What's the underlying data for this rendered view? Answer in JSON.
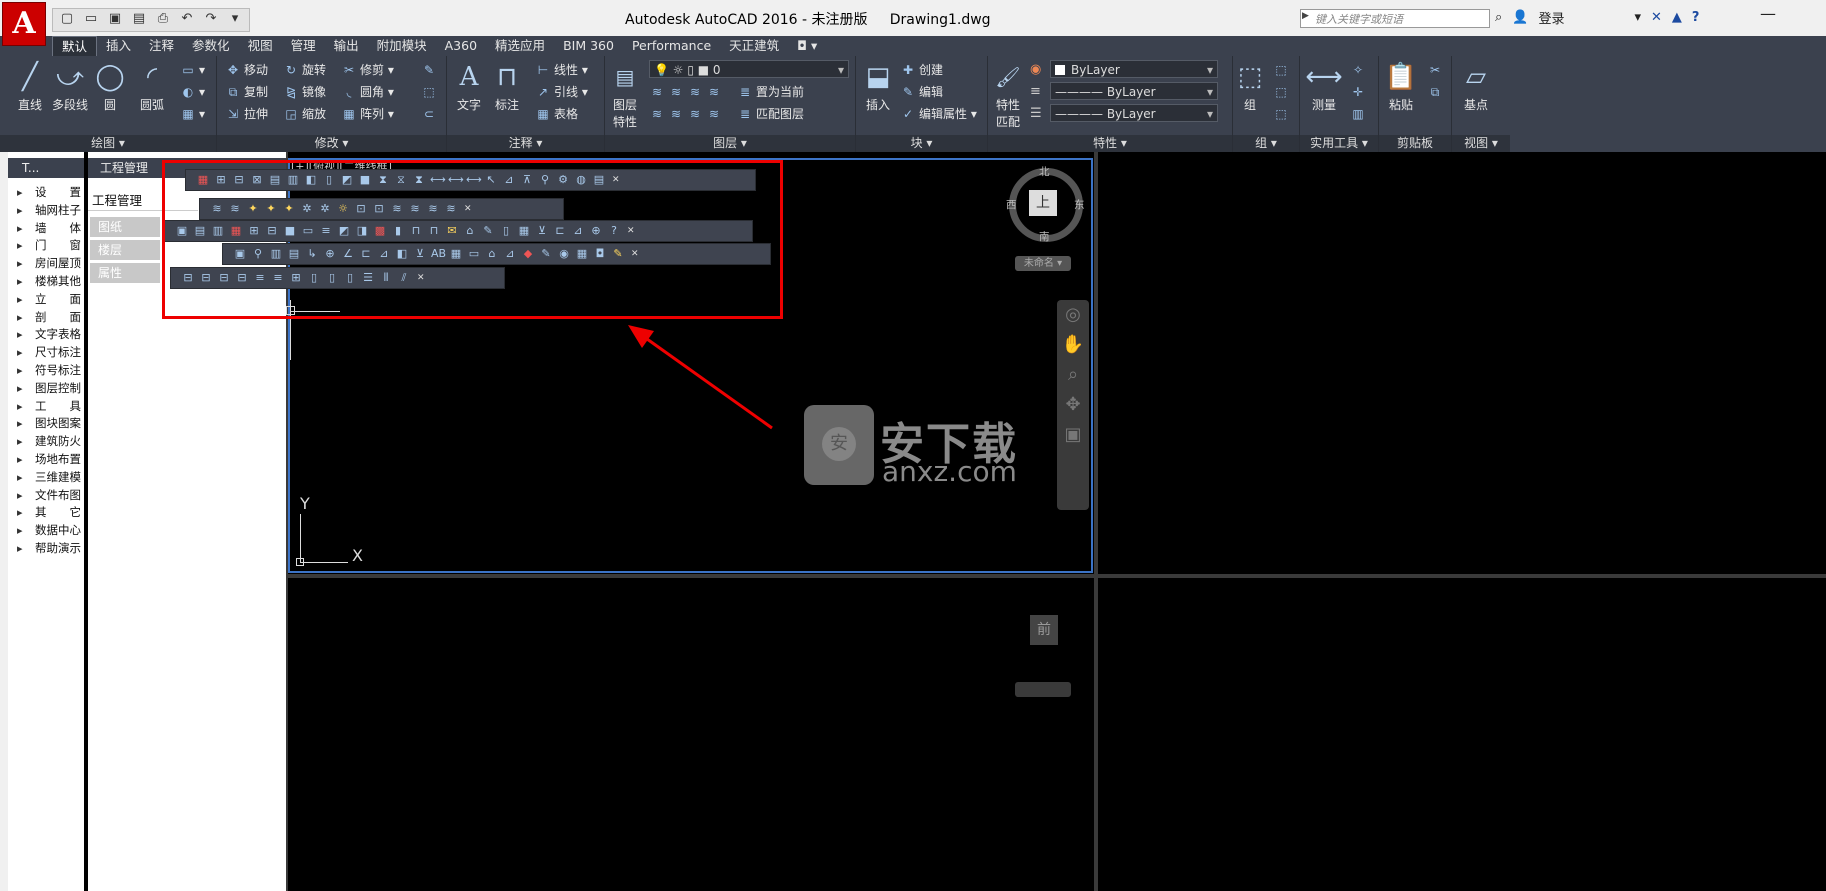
{
  "app": {
    "logo": "A",
    "window_title": "Autodesk AutoCAD 2016 - 未注册版     Drawing1.dwg",
    "search_placeholder": "键入关键字或短语",
    "login_label": "登录"
  },
  "qat": [
    "new",
    "open",
    "save",
    "save-as",
    "print",
    "undo",
    "redo",
    "menu"
  ],
  "tabs": [
    {
      "label": "默认",
      "active": true
    },
    {
      "label": "插入"
    },
    {
      "label": "注释"
    },
    {
      "label": "参数化"
    },
    {
      "label": "视图"
    },
    {
      "label": "管理"
    },
    {
      "label": "输出"
    },
    {
      "label": "附加模块"
    },
    {
      "label": "A360"
    },
    {
      "label": "精选应用"
    },
    {
      "label": "BIM 360"
    },
    {
      "label": "Performance"
    },
    {
      "label": "天正建筑"
    }
  ],
  "ribbon": {
    "draw": {
      "title": "绘图",
      "line": "直线",
      "polyline": "多段线",
      "circle": "圆",
      "arc": "圆弧"
    },
    "modify": {
      "title": "修改",
      "move": "移动",
      "rotate": "旋转",
      "trim": "修剪",
      "copy": "复制",
      "mirror": "镜像",
      "fillet": "圆角",
      "stretch": "拉伸",
      "scale": "缩放",
      "array": "阵列"
    },
    "annotation": {
      "title": "注释",
      "text": "文字",
      "dimension": "标注",
      "linear": "线性",
      "leader": "引线",
      "table": "表格"
    },
    "layers": {
      "title": "图层",
      "props_line1": "图层",
      "props_line2": "特性",
      "current_layer": "0",
      "set_current": "置为当前",
      "match_layer": "匹配图层"
    },
    "block": {
      "title": "块",
      "insert": "插入",
      "create": "创建",
      "edit": "编辑",
      "edit_attr": "编辑属性"
    },
    "properties": {
      "title": "特性",
      "match_line1": "特性",
      "match_line2": "匹配",
      "color": "ByLayer",
      "linetype": "ByLayer",
      "lineweight": "ByLayer"
    },
    "groups": {
      "title": "组",
      "group": "组"
    },
    "utilities": {
      "title": "实用工具",
      "measure": "测量"
    },
    "clipboard": {
      "title": "剪贴板",
      "paste": "粘贴"
    },
    "view": {
      "title": "视图",
      "base": "基点"
    }
  },
  "left_panel": {
    "header": "T...",
    "items": [
      "设　　置",
      "轴网柱子",
      "墙　　体",
      "门　　窗",
      "房间屋顶",
      "楼梯其他",
      "立　　面",
      "剖　　面",
      "文字表格",
      "尺寸标注",
      "符号标注",
      "图层控制",
      "工　　具",
      "图块图案",
      "建筑防火",
      "场地布置",
      "三维建模",
      "文件布图",
      "其　　它",
      "数据中心",
      "帮助演示"
    ]
  },
  "project_panel": {
    "header": "工程管理",
    "title": "工程管理",
    "tabs": [
      "图纸",
      "楼层",
      "属性"
    ]
  },
  "viewport": {
    "label": "[+][俯视][二维线框]",
    "compass": {
      "north": "北",
      "south": "南",
      "east": "东",
      "west": "西",
      "top": "上"
    },
    "wcs": "未命名 ▾",
    "ucs_x": "X",
    "ucs_y": "Y",
    "lower_cube": "前"
  },
  "watermark": {
    "text": "安下载",
    "url": "anxz.com"
  },
  "colors": {
    "accent_red": "#e00000",
    "viewport_border": "#3c74c7",
    "ribbon_bg": "#3b414e"
  }
}
